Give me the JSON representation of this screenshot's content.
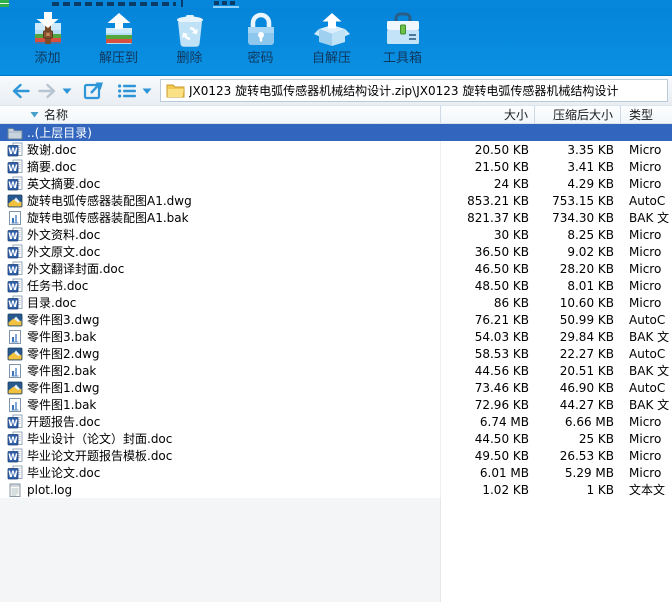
{
  "colors": {
    "toolbar_blue": "#0787DC",
    "selected_row_blue": "#3266BE",
    "toolbar_label": "#10375C"
  },
  "toolbar": {
    "buttons": [
      {
        "label": "添加",
        "icon": "add-package-icon"
      },
      {
        "label": "解压到",
        "icon": "extract-to-icon"
      },
      {
        "label": "删除",
        "icon": "delete-trash-icon"
      },
      {
        "label": "密码",
        "icon": "password-lock-icon"
      },
      {
        "label": "自解压",
        "icon": "self-extract-icon"
      },
      {
        "label": "工具箱",
        "icon": "toolbox-icon"
      }
    ]
  },
  "navbar": {
    "address": "JX0123 旋转电弧传感器机械结构设计.zip\\JX0123 旋转电弧传感器机械结构设计"
  },
  "filelist": {
    "columns": [
      "名称",
      "大小",
      "压缩后大小",
      "类型"
    ],
    "rows": [
      {
        "name": "..(上层目录)",
        "icon": "folder-icon",
        "size": "",
        "packed": "",
        "type": "",
        "selected": true
      },
      {
        "name": "致谢.doc",
        "icon": "word-doc-icon",
        "size": "20.50 KB",
        "packed": "3.35 KB",
        "type": "Micro"
      },
      {
        "name": "摘要.doc",
        "icon": "word-doc-icon",
        "size": "21.50 KB",
        "packed": "3.41 KB",
        "type": "Micro"
      },
      {
        "name": "英文摘要.doc",
        "icon": "word-doc-icon",
        "size": "24 KB",
        "packed": "4.29 KB",
        "type": "Micro"
      },
      {
        "name": "旋转电弧传感器装配图A1.dwg",
        "icon": "dwg-drawing-icon",
        "size": "853.21 KB",
        "packed": "753.15 KB",
        "type": "AutoC"
      },
      {
        "name": "旋转电弧传感器装配图A1.bak",
        "icon": "bak-file-icon",
        "size": "821.37 KB",
        "packed": "734.30 KB",
        "type": "BAK 文"
      },
      {
        "name": "外文资料.doc",
        "icon": "word-doc-icon",
        "size": "30 KB",
        "packed": "8.25 KB",
        "type": "Micro"
      },
      {
        "name": "外文原文.doc",
        "icon": "word-doc-icon",
        "size": "36.50 KB",
        "packed": "9.02 KB",
        "type": "Micro"
      },
      {
        "name": "外文翻译封面.doc",
        "icon": "word-doc-icon",
        "size": "46.50 KB",
        "packed": "28.20 KB",
        "type": "Micro"
      },
      {
        "name": "任务书.doc",
        "icon": "word-doc-icon",
        "size": "48.50 KB",
        "packed": "8.01 KB",
        "type": "Micro"
      },
      {
        "name": "目录.doc",
        "icon": "word-doc-icon",
        "size": "86 KB",
        "packed": "10.60 KB",
        "type": "Micro"
      },
      {
        "name": "零件图3.dwg",
        "icon": "dwg-drawing-icon",
        "size": "76.21 KB",
        "packed": "50.99 KB",
        "type": "AutoC"
      },
      {
        "name": "零件图3.bak",
        "icon": "bak-file-icon",
        "size": "54.03 KB",
        "packed": "29.84 KB",
        "type": "BAK 文"
      },
      {
        "name": "零件图2.dwg",
        "icon": "dwg-drawing-icon",
        "size": "58.53 KB",
        "packed": "22.27 KB",
        "type": "AutoC"
      },
      {
        "name": "零件图2.bak",
        "icon": "bak-file-icon",
        "size": "44.56 KB",
        "packed": "20.51 KB",
        "type": "BAK 文"
      },
      {
        "name": "零件图1.dwg",
        "icon": "dwg-drawing-icon",
        "size": "73.46 KB",
        "packed": "46.90 KB",
        "type": "AutoC"
      },
      {
        "name": "零件图1.bak",
        "icon": "bak-file-icon",
        "size": "72.96 KB",
        "packed": "44.27 KB",
        "type": "BAK 文"
      },
      {
        "name": "开题报告.doc",
        "icon": "word-doc-icon",
        "size": "6.74 MB",
        "packed": "6.66 MB",
        "type": "Micro"
      },
      {
        "name": "毕业设计（论文）封面.doc",
        "icon": "word-doc-icon",
        "size": "44.50 KB",
        "packed": "25 KB",
        "type": "Micro"
      },
      {
        "name": "毕业论文开题报告模板.doc",
        "icon": "word-doc-icon",
        "size": "49.50 KB",
        "packed": "26.53 KB",
        "type": "Micro"
      },
      {
        "name": "毕业论文.doc",
        "icon": "word-doc-icon",
        "size": "6.01 MB",
        "packed": "5.29 MB",
        "type": "Micro"
      },
      {
        "name": "plot.log",
        "icon": "log-file-icon",
        "size": "1.02 KB",
        "packed": "1 KB",
        "type": "文本文"
      }
    ]
  }
}
